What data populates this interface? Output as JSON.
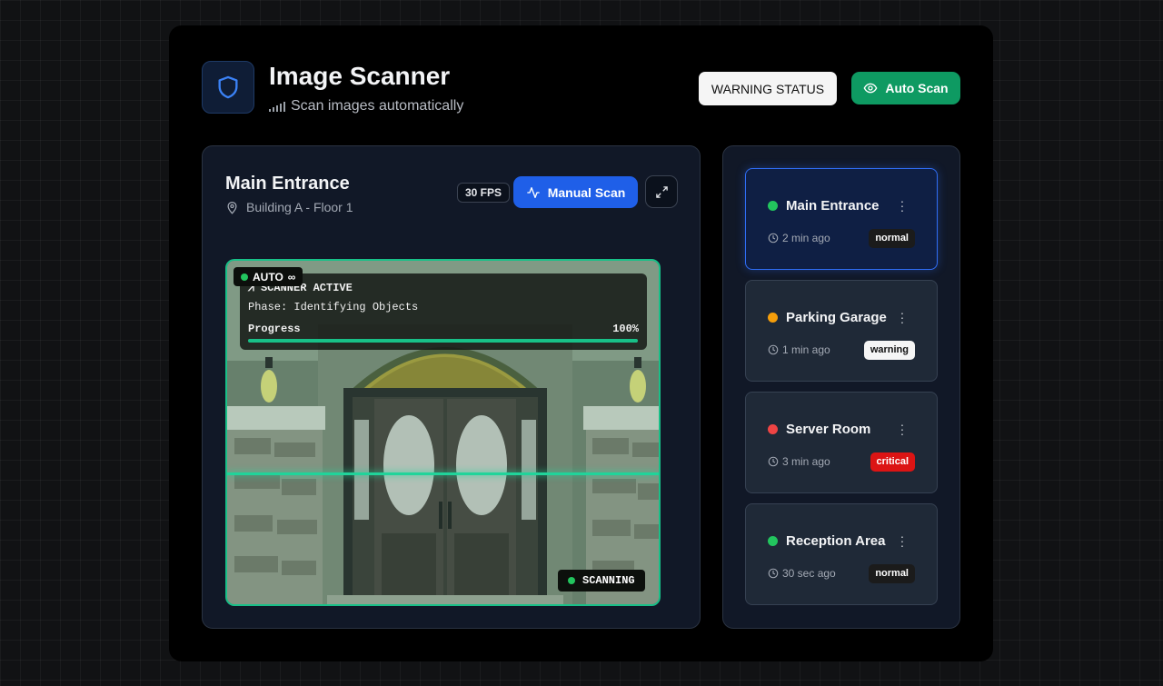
{
  "header": {
    "title": "Image Scanner",
    "subtitle": "Scan images automatically",
    "warning_button": "WARNING STATUS",
    "auto_scan_button": "Auto Scan"
  },
  "camera_view": {
    "name": "Main Entrance",
    "location": "Building A - Floor 1",
    "fps": "30 FPS",
    "manual_scan_button": "Manual Scan",
    "auto_badge": "AUTO",
    "auto_badge_symbol": "∞",
    "scanner": {
      "heading": "SCANNER ACTIVE",
      "phase": "Phase: Identifying Objects",
      "progress_label": "Progress",
      "progress_text": "100%",
      "progress_value": 1.0
    },
    "scanning_label": "SCANNING"
  },
  "cameras": [
    {
      "name": "Main Entrance",
      "time": "2 min ago",
      "status": "normal",
      "status_color": "#22c55e",
      "selected": true
    },
    {
      "name": "Parking Garage",
      "time": "1 min ago",
      "status": "warning",
      "status_color": "#f59e0b",
      "selected": false
    },
    {
      "name": "Server Room",
      "time": "3 min ago",
      "status": "critical",
      "status_color": "#ef4444",
      "selected": false
    },
    {
      "name": "Reception Area",
      "time": "30 sec ago",
      "status": "normal",
      "status_color": "#22c55e",
      "selected": false
    }
  ],
  "colors": {
    "accent_blue": "#1f5fe8",
    "accent_green": "#0e9a62",
    "scan_green": "#18c088"
  }
}
